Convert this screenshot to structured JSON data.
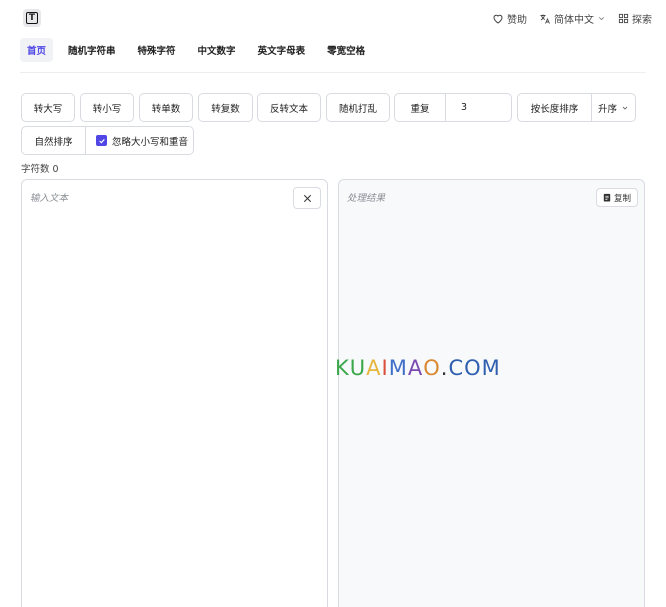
{
  "header": {
    "logo_letter": "T",
    "sponsor": "赞助",
    "language": "简体中文",
    "explore": "探索"
  },
  "nav": {
    "tabs": [
      {
        "label": "首页",
        "active": true
      },
      {
        "label": "随机字符串",
        "active": false
      },
      {
        "label": "特殊字符",
        "active": false
      },
      {
        "label": "中文数字",
        "active": false
      },
      {
        "label": "英文字母表",
        "active": false
      },
      {
        "label": "零宽空格",
        "active": false
      }
    ]
  },
  "toolbar": {
    "uppercase": "转大写",
    "lowercase": "转小写",
    "singular": "转单数",
    "plural": "转复数",
    "reverse": "反转文本",
    "shuffle": "随机打乱",
    "repeat_label": "重复",
    "repeat_value": "3",
    "sort_by_length": "按长度排序",
    "sort_order": "升序",
    "natural_sort": "自然排序",
    "ignore_case_accent": "忽略大小写和重音",
    "ignore_checked": true
  },
  "status": {
    "char_count": "字符数 0"
  },
  "input_panel": {
    "placeholder": "输入文本"
  },
  "output_panel": {
    "placeholder": "处理结果",
    "copy_label": "复制"
  },
  "watermark": {
    "text": "KUAIMAO.COM"
  },
  "colors": {
    "accent": "#4f46e5",
    "border": "#d8dbe0",
    "output_bg": "#f8f9fb"
  }
}
